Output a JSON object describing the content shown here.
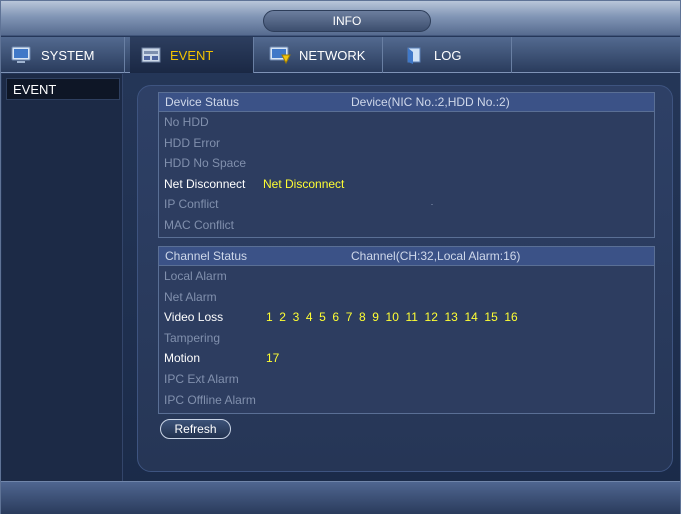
{
  "title": "INFO",
  "tabs": [
    {
      "label": "SYSTEM",
      "icon": "system-icon"
    },
    {
      "label": "EVENT",
      "icon": "event-icon"
    },
    {
      "label": "NETWORK",
      "icon": "network-icon"
    },
    {
      "label": "LOG",
      "icon": "log-icon"
    }
  ],
  "sidebar": {
    "items": [
      {
        "label": "EVENT"
      }
    ]
  },
  "device_status": {
    "header": "Device Status",
    "summary": "Device(NIC No.:2,HDD No.:2)",
    "rows": [
      {
        "label": "No HDD",
        "value": ""
      },
      {
        "label": "HDD Error",
        "value": ""
      },
      {
        "label": "HDD No Space",
        "value": ""
      },
      {
        "label": "Net Disconnect",
        "value": "Net Disconnect"
      },
      {
        "label": "IP Conflict",
        "value": ""
      },
      {
        "label": "MAC Conflict",
        "value": ""
      }
    ]
  },
  "channel_status": {
    "header": "Channel Status",
    "summary": "Channel(CH:32,Local Alarm:16)",
    "rows": [
      {
        "label": "Local Alarm",
        "values": []
      },
      {
        "label": "Net Alarm",
        "values": []
      },
      {
        "label": "Video Loss",
        "values": [
          "1",
          "2",
          "3",
          "4",
          "5",
          "6",
          "7",
          "8",
          "9",
          "10",
          "11",
          "12",
          "13",
          "14",
          "15",
          "16"
        ]
      },
      {
        "label": "Tampering",
        "values": []
      },
      {
        "label": "Motion",
        "values": [
          "17"
        ]
      },
      {
        "label": "IPC Ext Alarm",
        "values": []
      },
      {
        "label": "IPC Offline Alarm",
        "values": []
      }
    ]
  },
  "buttons": {
    "refresh": "Refresh"
  },
  "colors": {
    "active_tab": "#f2c200",
    "alarm_value": "#ffff33",
    "inactive_label": "#8190ad"
  }
}
